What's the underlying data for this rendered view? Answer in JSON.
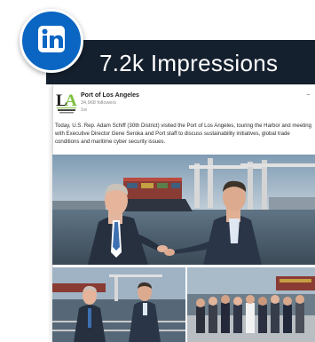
{
  "banner": {
    "impressions_text": "7.2k Impressions",
    "color": "#15202e"
  },
  "badge": {
    "icon": "linkedin-icon",
    "color": "#0a66c2"
  },
  "post": {
    "author": "Port of Los Angeles",
    "followers": "34,968 followers",
    "age": "1w",
    "logo_text": "LA",
    "logo_subtext": "THE PORT OF LOS ANGELES",
    "logo_color": "#7cbf3f",
    "menu_label": "...",
    "body": "Today, U.S. Rep. Adam Schiff (30th District) visited the Port of Los Angeles, touring the Harbor and meeting with Executive Director Gene Seroka and Port staff to discuss sustainability initiatives, global trade conditions and maritime cyber security issues."
  },
  "photos": [
    {
      "name": "main-photo",
      "icon": "harbor-meeting-photo"
    },
    {
      "name": "handshake-photo",
      "icon": "boat-deck-photo"
    },
    {
      "name": "group-photo",
      "icon": "group-on-deck-photo"
    }
  ]
}
